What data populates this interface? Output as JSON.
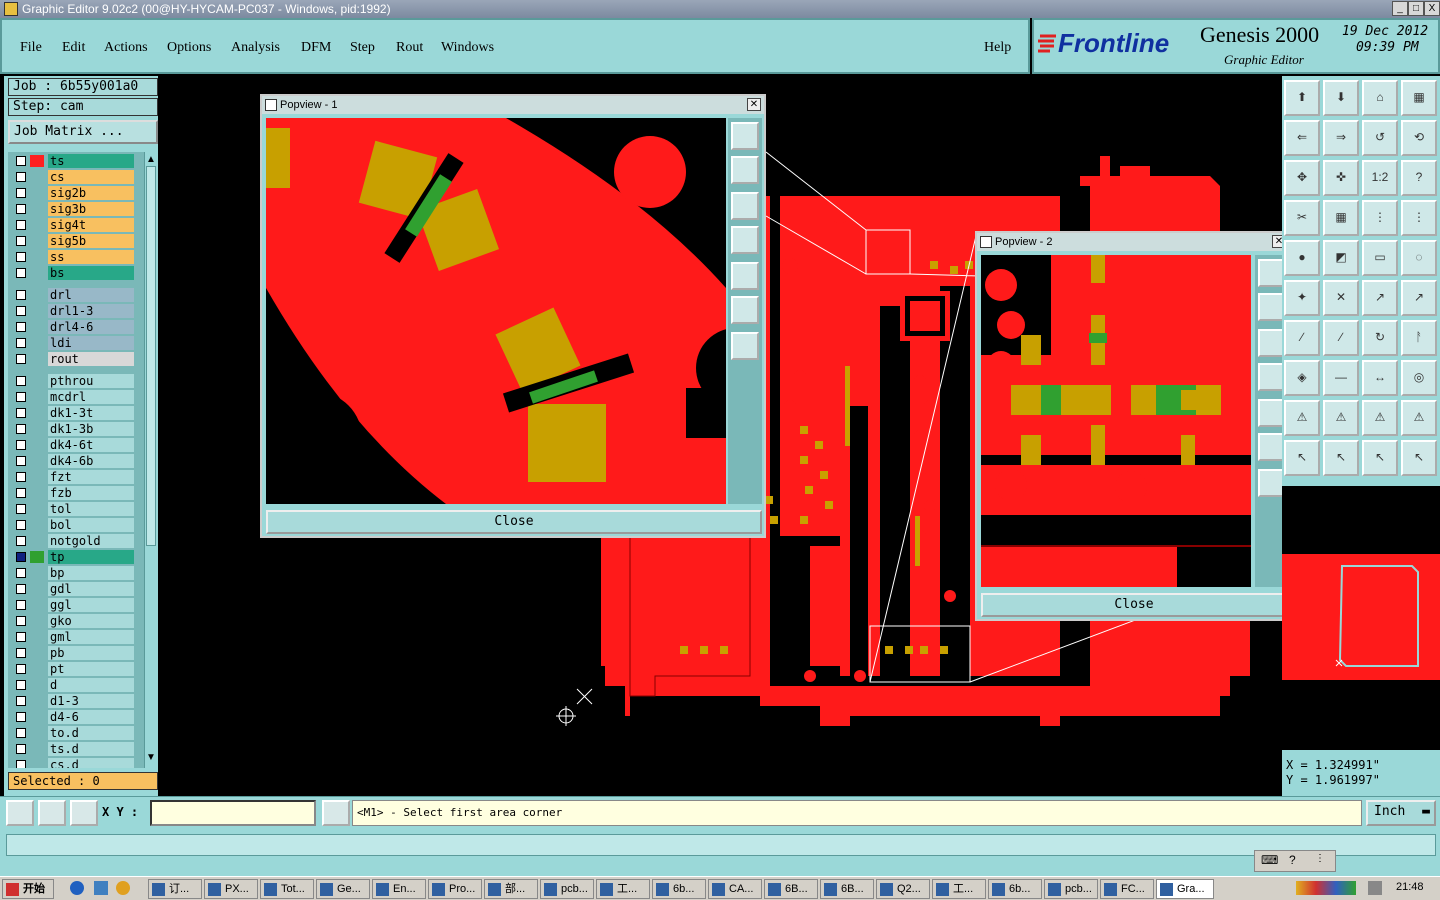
{
  "window": {
    "title": "Graphic Editor 9.02c2 (00@HY-HYCAM-PC037 - Windows, pid:1992)",
    "min": "_",
    "max": "□",
    "close": "X"
  },
  "menu": [
    "File",
    "Edit",
    "Actions",
    "Options",
    "Analysis",
    "DFM",
    "Step",
    "Rout",
    "Windows"
  ],
  "help": "Help",
  "brand": {
    "logo": "Frontline",
    "product": "Genesis 2000",
    "subtitle": "Graphic Editor",
    "date": "19 Dec 2012",
    "time": "09:39 PM"
  },
  "job": "Job : 6b55y001a0",
  "step": "Step: cam",
  "job_matrix": "Job Matrix ...",
  "layers": [
    {
      "name": "ts",
      "color": "#28a888",
      "swatch": "#ff2020"
    },
    {
      "name": "cs",
      "color": "#f8c060",
      "swatch": ""
    },
    {
      "name": "sig2b",
      "color": "#f8c060",
      "swatch": ""
    },
    {
      "name": "sig3b",
      "color": "#f8c060",
      "swatch": ""
    },
    {
      "name": "sig4t",
      "color": "#f8c060",
      "swatch": ""
    },
    {
      "name": "sig5b",
      "color": "#f8c060",
      "swatch": ""
    },
    {
      "name": "ss",
      "color": "#f8c060",
      "swatch": ""
    },
    {
      "name": "bs",
      "color": "#28a888",
      "swatch": ""
    },
    {
      "name": "drl",
      "color": "#98b8c8",
      "swatch": ""
    },
    {
      "name": "drl1-3",
      "color": "#98b8c8",
      "swatch": ""
    },
    {
      "name": "drl4-6",
      "color": "#98b8c8",
      "swatch": ""
    },
    {
      "name": "ldi",
      "color": "#98b8c8",
      "swatch": ""
    },
    {
      "name": "rout",
      "color": "#d8d8d8",
      "swatch": ""
    },
    {
      "name": "pthrou",
      "color": "#a8dada",
      "swatch": ""
    },
    {
      "name": "mcdrl",
      "color": "#a8dada",
      "swatch": ""
    },
    {
      "name": "dk1-3t",
      "color": "#a8dada",
      "swatch": ""
    },
    {
      "name": "dk1-3b",
      "color": "#a8dada",
      "swatch": ""
    },
    {
      "name": "dk4-6t",
      "color": "#a8dada",
      "swatch": ""
    },
    {
      "name": "dk4-6b",
      "color": "#a8dada",
      "swatch": ""
    },
    {
      "name": "fzt",
      "color": "#a8dada",
      "swatch": ""
    },
    {
      "name": "fzb",
      "color": "#a8dada",
      "swatch": ""
    },
    {
      "name": "tol",
      "color": "#a8dada",
      "swatch": ""
    },
    {
      "name": "bol",
      "color": "#a8dada",
      "swatch": ""
    },
    {
      "name": "notgold",
      "color": "#a8dada",
      "swatch": ""
    },
    {
      "name": "tp",
      "color": "#28a888",
      "swatch": "#30a030"
    },
    {
      "name": "bp",
      "color": "#a8dada",
      "swatch": ""
    },
    {
      "name": "gdl",
      "color": "#a8dada",
      "swatch": ""
    },
    {
      "name": "ggl",
      "color": "#a8dada",
      "swatch": ""
    },
    {
      "name": "gko",
      "color": "#a8dada",
      "swatch": ""
    },
    {
      "name": "gml",
      "color": "#a8dada",
      "swatch": ""
    },
    {
      "name": "pb",
      "color": "#a8dada",
      "swatch": ""
    },
    {
      "name": "pt",
      "color": "#a8dada",
      "swatch": ""
    },
    {
      "name": "d",
      "color": "#a8dada",
      "swatch": ""
    },
    {
      "name": "d1-3",
      "color": "#a8dada",
      "swatch": ""
    },
    {
      "name": "d4-6",
      "color": "#a8dada",
      "swatch": ""
    },
    {
      "name": "to.d",
      "color": "#a8dada",
      "swatch": ""
    },
    {
      "name": "ts.d",
      "color": "#a8dada",
      "swatch": ""
    },
    {
      "name": "cs.d",
      "color": "#a8dada",
      "swatch": ""
    }
  ],
  "selected": "Selected : 0",
  "popup1": {
    "title": "Popview - 1",
    "close_label": "Close"
  },
  "popup2": {
    "title": "Popview - 2",
    "close_label": "Close"
  },
  "toolbuttons": [
    "⬆",
    "⬇",
    "⌂",
    "▦",
    "⇐",
    "⇒",
    "↺",
    "⟲",
    "✥",
    "✜",
    "1:2",
    "?",
    "✂",
    "▦",
    "⋮",
    "⋮",
    "●",
    "◩",
    "▭",
    "◌",
    "✦",
    "✕",
    "↗",
    "↗",
    "∕",
    "∕",
    "↻",
    "ᚨ",
    "◈",
    "—",
    "↔",
    "◎",
    "⚠",
    "⚠",
    "⚠",
    "⚠",
    "↖",
    "↖",
    "↖",
    "↖"
  ],
  "coords": {
    "x": "X = 1.324991\"",
    "y": "Y = 1.961997\""
  },
  "cmd": {
    "xy_label": "X Y :",
    "prompt": "<M1> - Select first area corner",
    "units": "Inch"
  },
  "taskbar": {
    "start": "开始",
    "clock": "21:48",
    "items": [
      "订...",
      "PX...",
      "Tot...",
      "Ge...",
      "En...",
      "Pro...",
      "部...",
      "pcb...",
      "工...",
      "6b...",
      "CA...",
      "6B...",
      "6B...",
      "Q2...",
      "工...",
      "6b...",
      "pcb...",
      "FC...",
      "Gra..."
    ]
  }
}
